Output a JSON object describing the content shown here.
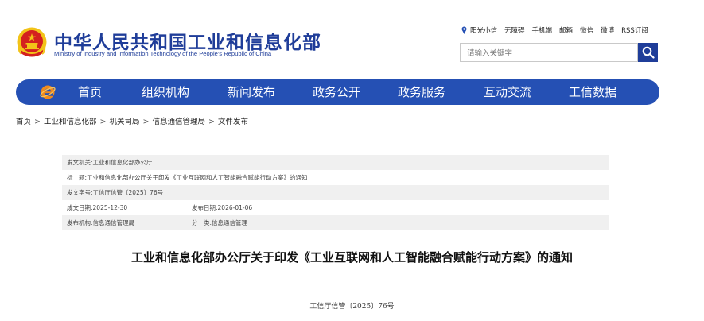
{
  "header": {
    "title": "中华人民共和国工业和信息化部",
    "subtitle": "Ministry of Industry and Information Technology of the People's Republic of China",
    "top_links": [
      "阳光小信",
      "无障碍",
      "手机端",
      "邮箱",
      "微信",
      "微博",
      "RSS订阅"
    ],
    "search_placeholder": "请输入关键字"
  },
  "nav": {
    "items": [
      "首页",
      "组织机构",
      "新闻发布",
      "政务公开",
      "政务服务",
      "互动交流",
      "工信数据"
    ]
  },
  "breadcrumb": [
    "首页",
    "工业和信息化部",
    "机关司局",
    "信息通信管理局",
    "文件发布"
  ],
  "doc_info": {
    "issuer_label": "发文机关:",
    "issuer": "工业和信息化部办公厅",
    "title_label": "标　题:",
    "title": "工业和信息化部办公厅关于印发《工业互联网和人工智能融合赋能行动方案》的通知",
    "number_label": "发文字号:",
    "number": "工信厅信管〔2025〕76号",
    "created_label": "成文日期:",
    "created": "2025-12-30",
    "published_label": "发布日期:",
    "published": "2026-01-06",
    "org_label": "发布机构:",
    "org": "信息通信管理局",
    "category_label": "分　类:",
    "category": "信息通信管理"
  },
  "article": {
    "title": "工业和信息化部办公厅关于印发《工业互联网和人工智能融合赋能行动方案》的通知",
    "doc_number": "工信厅信管〔2025〕76号"
  },
  "colors": {
    "brand_blue": "#1f3d99",
    "nav_blue": "#2550b4",
    "emblem_red": "#d4201f",
    "emblem_gold": "#f2c318"
  }
}
